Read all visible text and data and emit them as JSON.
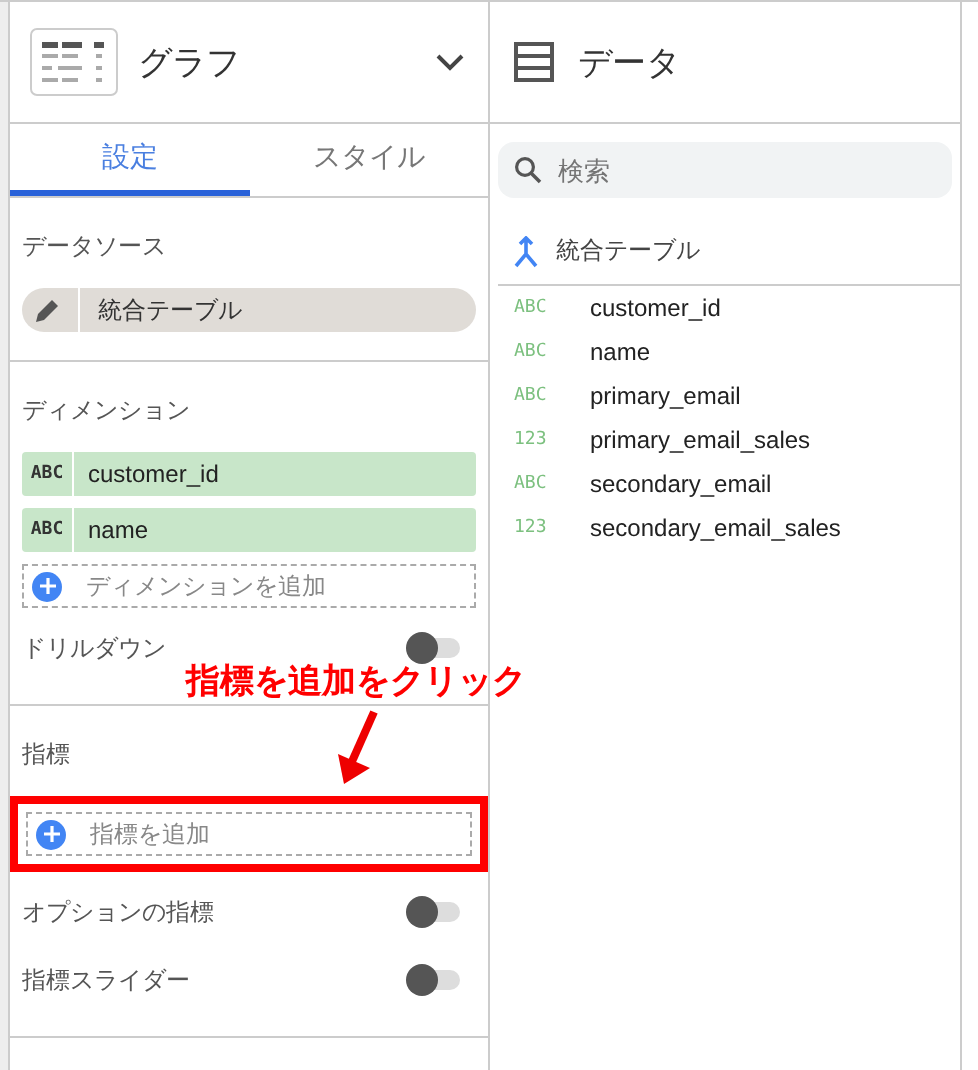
{
  "chart_panel": {
    "title": "グラフ",
    "tabs": [
      {
        "label": "設定",
        "selected": true
      },
      {
        "label": "スタイル",
        "selected": false
      }
    ],
    "data_source": {
      "heading": "データソース",
      "value": "統合テーブル"
    },
    "dimensions": {
      "heading": "ディメンション",
      "fields": [
        {
          "type": "ABC",
          "name": "customer_id"
        },
        {
          "type": "ABC",
          "name": "name"
        }
      ],
      "add_label": "ディメンションを追加"
    },
    "drilldown": {
      "label": "ドリルダウン",
      "on": false
    },
    "metrics": {
      "heading": "指標",
      "add_label": "指標を追加",
      "highlighted": true
    },
    "toggles": [
      {
        "label": "オプションの指標",
        "on": false
      },
      {
        "label": "指標スライダー",
        "on": false
      }
    ]
  },
  "annotation": {
    "text": "指標を追加をクリック"
  },
  "data_panel": {
    "title": "データ",
    "search": {
      "placeholder": "検索"
    },
    "source": "統合テーブル",
    "fields": [
      {
        "type": "ABC",
        "name": "customer_id"
      },
      {
        "type": "ABC",
        "name": "name"
      },
      {
        "type": "ABC",
        "name": "primary_email"
      },
      {
        "type": "123",
        "name": "primary_email_sales"
      },
      {
        "type": "ABC",
        "name": "secondary_email"
      },
      {
        "type": "123",
        "name": "secondary_email_sales"
      }
    ]
  }
}
